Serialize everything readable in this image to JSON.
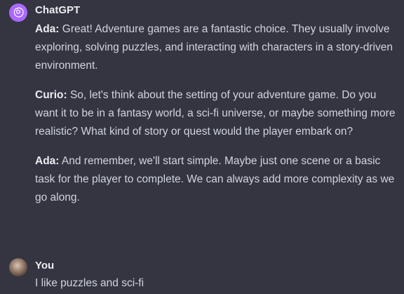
{
  "assistant": {
    "sender": "ChatGPT",
    "icon": "openai-logo-icon",
    "icon_bg": "#ab68ff",
    "paragraphs": [
      {
        "speaker": "Ada:",
        "text": " Great! Adventure games are a fantastic choice. They usually involve exploring, solving puzzles, and interacting with characters in a story-driven environment."
      },
      {
        "speaker": "Curio:",
        "text": " So, let's think about the setting of your adventure game. Do you want it to be in a fantasy world, a sci-fi universe, or maybe something more realistic? What kind of story or quest would the player embark on?"
      },
      {
        "speaker": "Ada:",
        "text": " And remember, we'll start simple. Maybe just one scene or a basic task for the player to complete. We can always add more complexity as we go along."
      }
    ]
  },
  "user": {
    "sender": "You",
    "icon": "user-avatar",
    "message": "I like puzzles and sci-fi"
  }
}
